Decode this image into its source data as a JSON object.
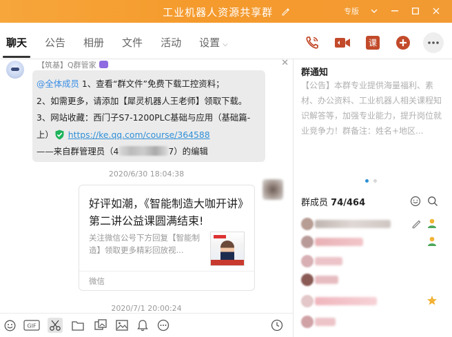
{
  "window": {
    "title": "工业机器人资源共享群",
    "mode_label": "专版"
  },
  "tabs": [
    {
      "label": "聊天",
      "active": true
    },
    {
      "label": "公告"
    },
    {
      "label": "相册"
    },
    {
      "label": "文件"
    },
    {
      "label": "活动"
    },
    {
      "label": "设置"
    }
  ],
  "toolbar_icons": [
    "phone-icon",
    "video-icon",
    "course-icon",
    "add-icon",
    "more-icon"
  ],
  "toolbar_course_label": "课",
  "message1": {
    "sender_prefix": "【筑基】",
    "sender": "Q群管家",
    "mention": "@全体成员",
    "line1": " 1、查看“群文件”免费下载工控资料；",
    "line2": "2、如需更多，请添加【犀灵机器人王老师】领取下载。",
    "line3": "3、网站收藏：西门子S7-1200PLC基础与应用（基础篇-",
    "line4_pre": "上）",
    "link": "https://ke.qq.com/course/364588",
    "footer_pre": "——来自群管理员（",
    "footer_id_start": "4",
    "footer_id_end": "7",
    "footer_post": "）的编辑"
  },
  "timestamp1": "2020/6/30 18:04:38",
  "card": {
    "title": "好评如潮，《智能制造大咖开讲》第二讲公益课圆满结束!",
    "desc": "关注微信公号下方回复【智能制造】领取更多精彩回放视...",
    "source": "微信"
  },
  "timestamp2": "2020/7/1 20:00:24",
  "input_icons": [
    "emoji-icon",
    "gif-icon",
    "scissors-icon",
    "folder-icon",
    "image-gallery-icon",
    "picture-icon",
    "bell-icon",
    "chat-more-icon",
    "history-clock-icon"
  ],
  "input_gif_label": "GIF",
  "notice": {
    "title": "群通知",
    "text": "【公告】本群专业提供海量福利、素材、办公资料、工业机器人相关课程知识解答等，加强专业能力，提升岗位就业竞争力！群备注：姓名+地区..."
  },
  "members": {
    "label": "群成员",
    "count": "74/464"
  },
  "colors": {
    "titlebar": "#f59a2c",
    "link": "#2f8fd8",
    "mention": "#3a8ee6",
    "bubble": "#ebebeb",
    "check": "#1fb35a"
  }
}
